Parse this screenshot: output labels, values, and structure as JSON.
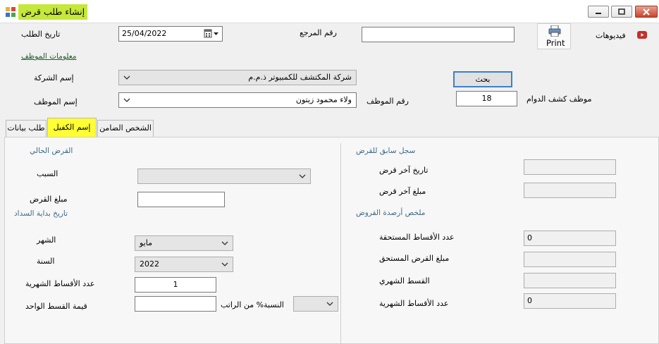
{
  "window": {
    "title": "إنشاء طلب قرض"
  },
  "header": {
    "videos_label": "فيديوهات",
    "print_label": "Print",
    "reference_label": "رقم المرجع",
    "reference_value": "",
    "request_date_label": "تاريخ الطلب",
    "request_date_value": "25/04/2022"
  },
  "employee_info": {
    "section_label": "معلومات الموظف",
    "company_label": "إسم الشركة",
    "company_value": "شركة المكتشف للكمبيوتر ذ.م.م",
    "search_label": "بحث",
    "employee_name_label": "إسم الموظف",
    "employee_name_value": "ولاء محمود زيتون",
    "employee_number_label": "رقم الموظف",
    "timesheet_employee_label": "موظف كشف الدوام",
    "timesheet_employee_value": "18"
  },
  "tabs": [
    {
      "label": "طلب بيانات"
    },
    {
      "label": "إسم الكفيل"
    },
    {
      "label": "الشخص الضامن"
    }
  ],
  "current_loan": {
    "section_label": "القرض الحالي",
    "reason_label": "السبب",
    "reason_value": "",
    "amount_label": "مبلغ القرض",
    "amount_value": ""
  },
  "repayment_start": {
    "section_label": "تاريخ بداية السداد",
    "month_label": "الشهر",
    "month_value": "مايو",
    "year_label": "السنة",
    "year_value": "2022",
    "installments_count_label": "عدد الأقساط الشهرية",
    "installments_count_value": "1",
    "installment_value_label": "قيمة القسط الواحد",
    "installment_value_value": "",
    "salary_percent_label": "النسبة% من الراتب",
    "salary_percent_value": ""
  },
  "loan_history": {
    "section_label": "سجل سابق للقرض",
    "last_loan_date_label": "تاريخ آخر قرض",
    "last_loan_date_value": "",
    "last_loan_amount_label": "مبلغ آخر قرض",
    "last_loan_amount_value": ""
  },
  "loan_balances": {
    "section_label": "ملخص أرصدة القروض",
    "due_installments_label": "عدد الأقساط المستحقة",
    "due_installments_value": "0",
    "due_amount_label": "مبلغ القرض المستحق",
    "due_amount_value": "",
    "monthly_installment_label": "القسط الشهري",
    "monthly_installment_value": "",
    "monthly_installments_count_label": "عدد الأقساط الشهرية",
    "monthly_installments_count_value": "0"
  },
  "colors": {
    "active_tab": "#ffff33",
    "title_highlight": "#c5e83a",
    "section_link": "#3e6a85",
    "video_icon": "#c4302b"
  }
}
